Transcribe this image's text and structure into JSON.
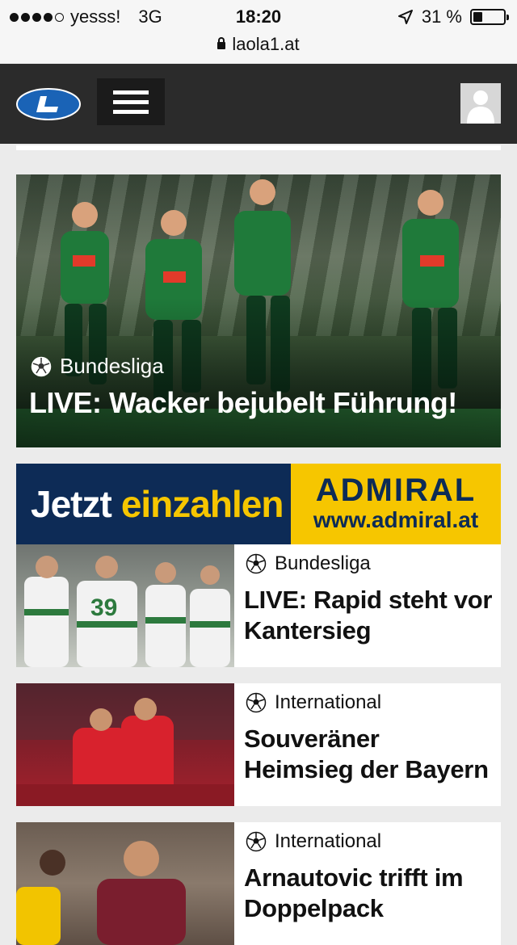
{
  "status_bar": {
    "carrier": "yesss!",
    "network": "3G",
    "time": "18:20",
    "battery": "31 %",
    "url": "laola1.at"
  },
  "header": {
    "logo_icon": "laola1-logo",
    "menu_icon": "hamburger-menu-icon",
    "user_icon": "user-avatar-icon"
  },
  "hero": {
    "category": "Bundesliga",
    "title": "LIVE: Wacker bejubelt Führung!"
  },
  "ad": {
    "left_text_1": "Jetzt",
    "left_text_2": "einzahlen",
    "brand": "ADMIRAL",
    "url": "www.admiral.at",
    "colors": {
      "navy": "#0d2b56",
      "yellow": "#f6c600"
    }
  },
  "articles": [
    {
      "category": "Bundesliga",
      "title": "LIVE: Rapid steht vor Kantersieg"
    },
    {
      "category": "International",
      "title": "Souveräner Heimsieg der Bayern"
    },
    {
      "category": "International",
      "title": "Arnautovic trifft im Doppelpack"
    }
  ],
  "colors": {
    "header_bg": "#2b2b2b",
    "page_bg": "#ebebeb",
    "logo_blue": "#1a63b6"
  }
}
